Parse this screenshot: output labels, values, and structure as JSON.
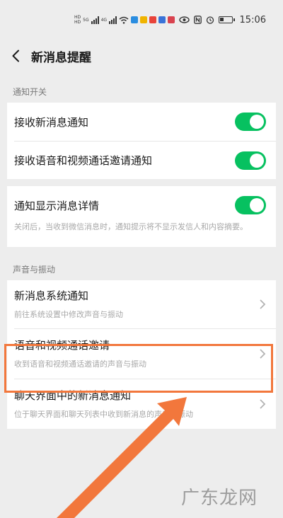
{
  "status_bar": {
    "network_tag_top": "HD",
    "network_tag_bottom": "HD",
    "net_5g": "5G",
    "net_4g": "4G",
    "time": "15:06"
  },
  "header": {
    "title": "新消息提醒"
  },
  "sections": {
    "notifications": {
      "label": "通知开关",
      "items": [
        {
          "title": "接收新消息通知",
          "toggle_on": true
        },
        {
          "title": "接收语音和视频通话邀请通知",
          "toggle_on": true
        }
      ]
    },
    "details": {
      "title": "通知显示消息详情",
      "toggle_on": true,
      "subtitle": "关闭后，当收到微信消息时，通知提示将不显示发信人和内容摘要。"
    },
    "sound": {
      "label": "声音与振动",
      "items": [
        {
          "title": "新消息系统通知",
          "subtitle": "前往系统设置中修改声音与振动"
        },
        {
          "title": "语音和视频通话邀请",
          "subtitle": "收到语音和视频通话邀请的声音与振动"
        },
        {
          "title": "聊天界面中的新消息通知",
          "subtitle": "位于聊天界面和聊天列表中收到新消息的声音与振动"
        }
      ]
    }
  },
  "colors": {
    "toggle_on": "#07c160",
    "highlight": "#f2773c",
    "background": "#ededed"
  },
  "watermark": "广东龙网"
}
